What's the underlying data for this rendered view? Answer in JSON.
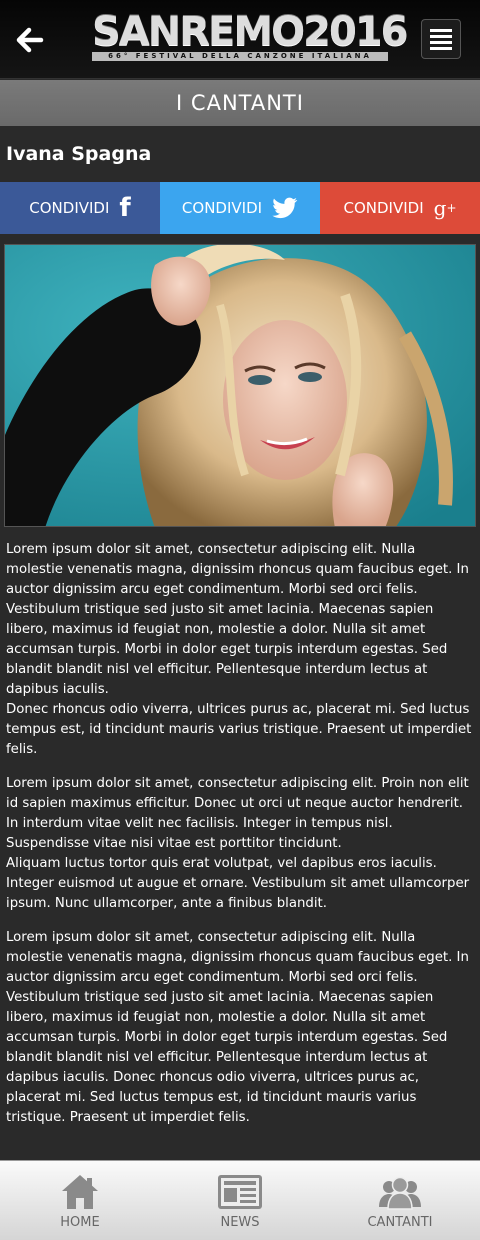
{
  "header": {
    "logo_main": "SANREMO2016",
    "logo_sub": "66° FESTIVAL DELLA CANZONE ITALIANA",
    "back_icon": "arrow-left-icon",
    "menu_icon": "hamburger-menu-icon"
  },
  "section": {
    "title": "I CANTANTI"
  },
  "artist": {
    "name": "Ivana Spagna"
  },
  "share": [
    {
      "label": "CONDIVIDI",
      "icon": "facebook-icon",
      "color": "#3b5998"
    },
    {
      "label": "CONDIVIDI",
      "icon": "twitter-icon",
      "color": "#3ba5ef"
    },
    {
      "label": "CONDIVIDI",
      "icon": "google-plus-icon",
      "color": "#dd4b39"
    }
  ],
  "content": {
    "p1": "Lorem ipsum dolor sit amet, consectetur adipiscing elit. Nulla molestie venenatis magna, dignissim rhoncus quam faucibus eget. In auctor dignis­sim arcu eget condimentum. Morbi sed orci felis. Vestibulum tristique sed justo sit amet lacinia. Maecenas sapien libero, maximus id feugiat non, molestie a dolor. Nulla sit amet accumsan turpis. Morbi in dolor eget turpis interdum egestas. Sed blandit blandit nisl vel efficitur. Pellentesque interdum lectus at dapibus iaculis.",
    "p2": "Donec rhoncus odio viverra, ultrices purus ac, placerat mi. Sed luctus tempus est, id tincidunt mauris varius tristique. Praesent ut imperdiet felis.",
    "p3": "Lorem ipsum dolor sit amet, consectetur adipiscing elit. Proin non elit id sapien maximus efficitur. Donec ut orci ut neque auctor hendrerit. In interdum vitae velit nec facilisis. Integer in tempus nisl. Suspendisse vitae nisi vitae est porttitor tincidunt.",
    "p4": "Aliquam luctus tortor quis erat volutpat, vel dapibus eros iaculis. Integer euismod ut augue et ornare. Vestibulum sit amet ullamcorper ipsum. Nunc ullamcorper, ante a finibus blandit.",
    "p5": "Lorem ipsum dolor sit amet, consectetur adipiscing elit. Nulla molestie venenatis magna, dignissim rhoncus quam faucibus eget. In auctor dignis­sim arcu eget condimentum. Morbi sed orci felis. Vestibulum tristique sed justo sit amet lacinia. Maecenas sapien libero, maximus id feugiat non, molestie a dolor. Nulla sit amet accumsan turpis. Morbi in dolor eget turpis interdum egestas. Sed blandit blandit nisl vel efficitur. Pellentesque interdum lectus at dapibus iaculis. Donec rhoncus odio viverra, ultrices purus ac, placerat mi. Sed luctus tempus est, id tincidunt mauris varius tristique. Praesent ut imperdiet felis."
  },
  "nav": [
    {
      "label": "HOME",
      "icon": "home-icon"
    },
    {
      "label": "NEWS",
      "icon": "newspaper-icon"
    },
    {
      "label": "CANTANTI",
      "icon": "users-icon"
    }
  ]
}
